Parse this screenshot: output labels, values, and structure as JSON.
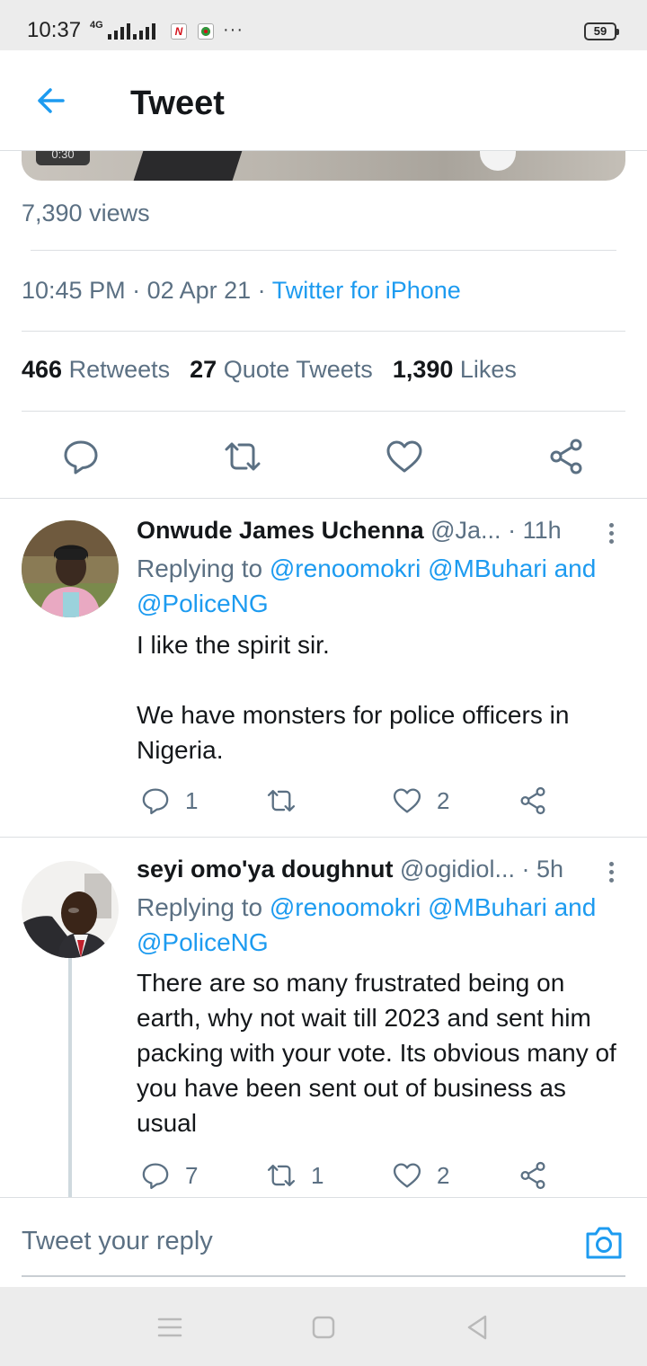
{
  "status_bar": {
    "time": "10:37",
    "network": "4G",
    "battery": "59"
  },
  "header": {
    "title": "Tweet"
  },
  "media": {
    "duration": "0:30"
  },
  "tweet": {
    "views": "7,390 views",
    "time": "10:45 PM",
    "date": "02 Apr 21",
    "source": "Twitter for iPhone",
    "retweets_count": "466",
    "retweets_label": "Retweets",
    "quotes_count": "27",
    "quotes_label": "Quote Tweets",
    "likes_count": "1,390",
    "likes_label": "Likes"
  },
  "replies": [
    {
      "name": "Onwude James Uchenna",
      "handle": "@Ja...",
      "time": "11h",
      "replying_prefix": "Replying to",
      "mentions_line1": "@renoomokri @MBuhari",
      "and": "and",
      "mentions_line2": "@PoliceNG",
      "text": "I like the spirit sir.\n\nWe have monsters for police officers in Nigeria.",
      "reply_count": "1",
      "retweet_count": "",
      "like_count": "2"
    },
    {
      "name": "seyi omo'ya doughnut",
      "handle": "@ogidiol...",
      "time": "5h",
      "replying_prefix": "Replying to",
      "mentions_line1": "@renoomokri @MBuhari",
      "and": "and",
      "mentions_line2": "@PoliceNG",
      "text": "There are so many frustrated being on earth, why not wait till 2023 and sent him packing with your vote. Its obvious many of you have been sent out of business as usual",
      "reply_count": "7",
      "retweet_count": "1",
      "like_count": "2"
    }
  ],
  "compose": {
    "placeholder": "Tweet your reply"
  },
  "colors": {
    "accent": "#1d9bf0",
    "secondary_text": "#5b7083",
    "primary_text": "#14171a"
  }
}
